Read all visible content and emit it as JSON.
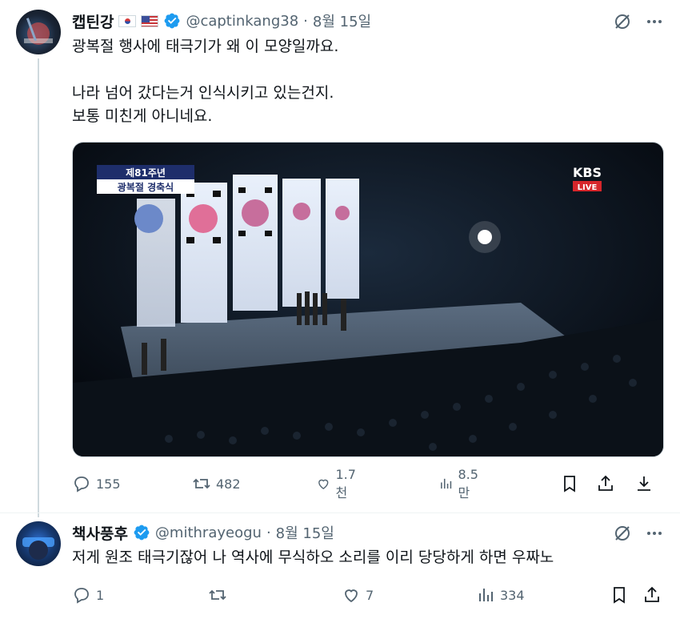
{
  "tweets": [
    {
      "display_name": "캡틴강",
      "flags": [
        "kr-flag",
        "us-flag"
      ],
      "handle": "@captinkang38",
      "separator": "·",
      "date": "8월 15일",
      "text": "광복절 행사에 태극기가 왜 이 모양일까요.\n\n나라 넘어 갔다는거 인식시키고 있는건지.\n보통 미친게 아니네요.",
      "media": {
        "caption_line1": "제81주년",
        "caption_line2": "광복절 경축식",
        "broadcaster": "KBS",
        "live_label": "LIVE"
      },
      "stats": {
        "replies": "155",
        "retweets": "482",
        "likes": "1.7천",
        "views": "8.5만"
      }
    },
    {
      "display_name": "책사풍후",
      "handle": "@mithrayeogu",
      "separator": "·",
      "date": "8월 15일",
      "text": "저게 원조 태극기잖어 나 역사에 무식하오 소리를 이리 당당하게 하면 우짜노",
      "stats": {
        "replies": "1",
        "retweets": "",
        "likes": "7",
        "views": "334"
      }
    }
  ],
  "colors": {
    "text": "#0f1419",
    "secondary": "#536471",
    "verified": "#1d9bf0",
    "divider": "#eff3f4"
  },
  "icons": [
    "grok-icon",
    "more-icon",
    "reply-icon",
    "retweet-icon",
    "like-icon",
    "views-icon",
    "bookmark-icon",
    "share-icon",
    "download-icon",
    "verified-badge-icon"
  ]
}
